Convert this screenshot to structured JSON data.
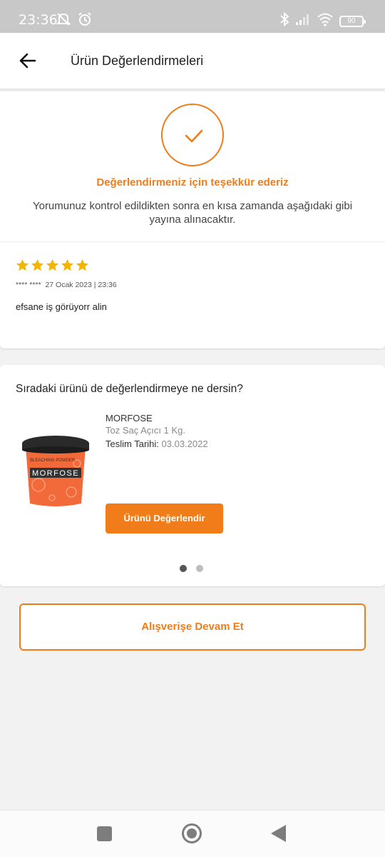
{
  "status_bar": {
    "time": "23:36",
    "battery": "90"
  },
  "header": {
    "title": "Ürün Değerlendirmeleri"
  },
  "thanks": {
    "title": "Değerlendirmeniz için teşekkür ederiz",
    "description": "Yorumunuz kontrol edildikten sonra en kısa zamanda aşağıdaki gibi yayına alınacaktır."
  },
  "review": {
    "rating": 5,
    "max_rating": 5,
    "meta": "**** ****  27 Ocak 2023 | 23:36",
    "text": "efsane iş görüyorr alin"
  },
  "next_product": {
    "title": "Sıradaki ürünü de değerlendirmeye ne dersin?",
    "brand": "MORFOSE",
    "name": "Toz Saç Açıcı 1 Kg.",
    "delivery_label": "Teslim Tarihi:",
    "delivery_date": "03.03.2022",
    "button_label": "Ürünü Değerlendir",
    "image_brand": "MORFOSE",
    "image_small_text": "BLEACHING POWDER",
    "pager_total": 2,
    "pager_active": 1
  },
  "continue_button": "Alışverişe Devam Et",
  "colors": {
    "accent": "#f07d19",
    "star": "#f5b400"
  }
}
